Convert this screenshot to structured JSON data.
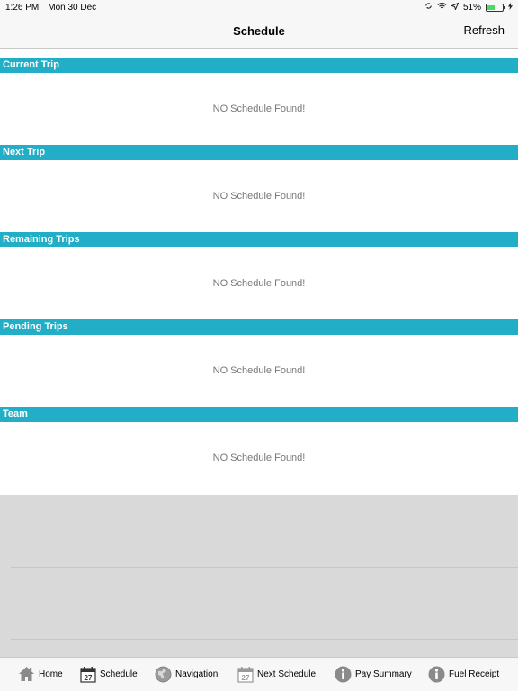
{
  "status_bar": {
    "time": "1:26 PM",
    "date": "Mon 30 Dec",
    "battery_percent": "51%",
    "battery_level": 0.51
  },
  "navbar": {
    "title": "Schedule",
    "refresh_label": "Refresh"
  },
  "sections": [
    {
      "title": "Current Trip",
      "empty_text": "NO Schedule Found!"
    },
    {
      "title": "Next Trip",
      "empty_text": "NO Schedule Found!"
    },
    {
      "title": "Remaining Trips",
      "empty_text": "NO Schedule Found!"
    },
    {
      "title": "Pending Trips",
      "empty_text": "NO Schedule Found!"
    },
    {
      "title": "Team",
      "empty_text": "NO Schedule Found!"
    }
  ],
  "tabs": [
    {
      "label": "Home",
      "icon": "home-icon"
    },
    {
      "label": "Schedule",
      "icon": "calendar-icon",
      "day": "27"
    },
    {
      "label": "Navigation",
      "icon": "globe-icon"
    },
    {
      "label": "Next Schedule",
      "icon": "calendar-icon",
      "day": "27"
    },
    {
      "label": "Pay Summary",
      "icon": "info-icon"
    },
    {
      "label": "Fuel Receipt",
      "icon": "info-icon"
    }
  ],
  "colors": {
    "section_header": "#21aec6",
    "battery_fill": "#4cd964",
    "tab_icon": "#8a8a8a"
  }
}
